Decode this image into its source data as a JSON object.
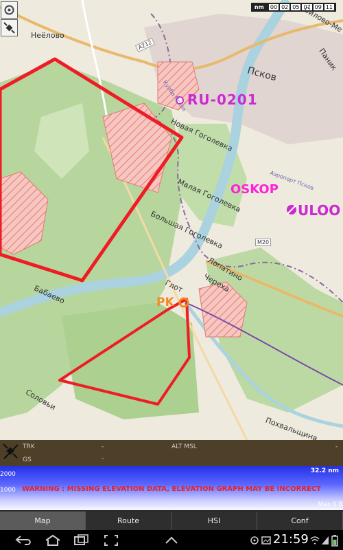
{
  "scale": {
    "unit": "nm",
    "ticks": [
      "00",
      "02",
      "05",
      "07",
      "09",
      "11"
    ]
  },
  "places": {
    "neelovo": "Неёлово",
    "pskov": "Псков",
    "silovo": "Силово-Ме",
    "panik": "Паник",
    "novaya": "Новая Гоголевка",
    "malaya": "Малая Гоголевка",
    "bolshaya": "Большая Гоголевка",
    "lopatino": "Лопатино",
    "chereha": "Череха",
    "glotovo": "Глот",
    "babaevo": "Бабаево",
    "solovy": "Соловьи",
    "pokhvalshchina": "Похвальщина",
    "airport": "Аэропорт Псков",
    "road_a212": "А212",
    "road_m20": "М20",
    "river": "Кулба Псков"
  },
  "waypoints": {
    "ru0201": "RU-0201",
    "oskop": "OSKOP",
    "uloo": "ULOO",
    "pk": "PK"
  },
  "info": {
    "trk_label": "TRK",
    "trk_value": "-",
    "gs_label": "GS",
    "gs_value": "-",
    "alt_label": "ALT MSL",
    "alt_value": "-"
  },
  "elevation": {
    "distance": "32.2 nm",
    "alt_top": "2000",
    "alt_mid": "1000",
    "max_label": "Max 0 ft",
    "warning": "WARNING : MISSING ELEVATION DATA, ELEVATION GRAPH MAY BE INCORRECT"
  },
  "tabs": [
    "Map",
    "Route",
    "HSI",
    "Conf"
  ],
  "status": {
    "time": "21:59"
  },
  "colors": {
    "airspace": "#ee1c25",
    "waypoint": "#cc2ad1",
    "pk": "#f08c1e",
    "route": "#7a4aa6"
  }
}
